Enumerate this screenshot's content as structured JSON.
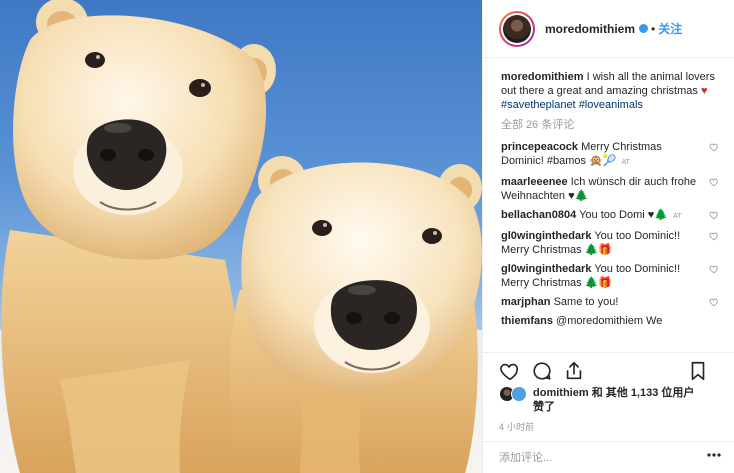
{
  "post": {
    "username": "moredomithiem",
    "follow_separator": "•",
    "follow_label": "关注",
    "caption": {
      "username": "moredomithiem",
      "text": "I wish all the animal lovers out there a great and amazing christmas",
      "heart": "♥",
      "tags": [
        "#savetheplanet",
        "#loveanimals"
      ]
    },
    "all_comments_label": "全部 26 条评论",
    "comments": [
      {
        "username": "princepeacock",
        "text": "Merry Christmas Dominic! #bamos 🙊🎾",
        "time": "AT"
      },
      {
        "username": "maarleeenee",
        "text": "Ich wünsch dir auch frohe Weihnachten ♥🌲",
        "time": ""
      },
      {
        "username": "bellachan0804",
        "text": "You too Domi ♥🌲",
        "time": "AT"
      },
      {
        "username": "gl0winginthedark",
        "text": "You too Dominic!! Merry Christmas 🌲🎁",
        "time": ""
      },
      {
        "username": "gl0winginthedark",
        "text": "You too Dominic!! Merry Christmas 🌲🎁",
        "time": ""
      },
      {
        "username": "marjphan",
        "text": "Same to you!",
        "time": ""
      },
      {
        "username": "thiemfans",
        "text": "@moredomithiem We",
        "time": ""
      }
    ],
    "likes": {
      "username": "domithiem",
      "text_mid": "和 其他",
      "count": "1,133",
      "text_end": "位用户",
      "text_line2": "赞了"
    },
    "timestamp": "4 小时前",
    "add_comment_placeholder": "添加评论...",
    "colors": {
      "accent_blue": "#3897f0",
      "hashtag": "#003569",
      "muted": "#999999",
      "heart_red": "#c0392b"
    }
  }
}
